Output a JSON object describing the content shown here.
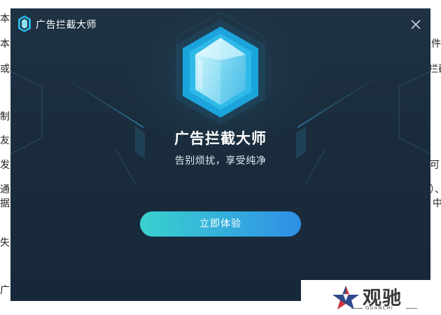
{
  "background_doc": {
    "lines": [
      "本车",
      "本车",
      "或者",
      "制",
      "友汇",
      "发",
      "通",
      "据",
      "失",
      "广"
    ],
    "right_lines": [
      "件",
      "拦截",
      "可",
      "）、",
      "中"
    ]
  },
  "window": {
    "title": "广告拦截大师",
    "close_icon": "close-icon",
    "logo_icon": "shield-logo-icon"
  },
  "hero": {
    "icon": "shield-icon",
    "title": "广告拦截大师",
    "subtitle": "告别烦扰，享受纯净"
  },
  "actions": {
    "try_label": "立即体验"
  },
  "watermark": {
    "text": "观驰",
    "sub": "GUANCHI"
  },
  "colors": {
    "dialog_bg": "#1a2c3c",
    "accent_start": "#3ad1cf",
    "accent_end": "#2f8fe6",
    "shield_light": "#9fe6f5",
    "shield_dark": "#1fa7e0"
  }
}
